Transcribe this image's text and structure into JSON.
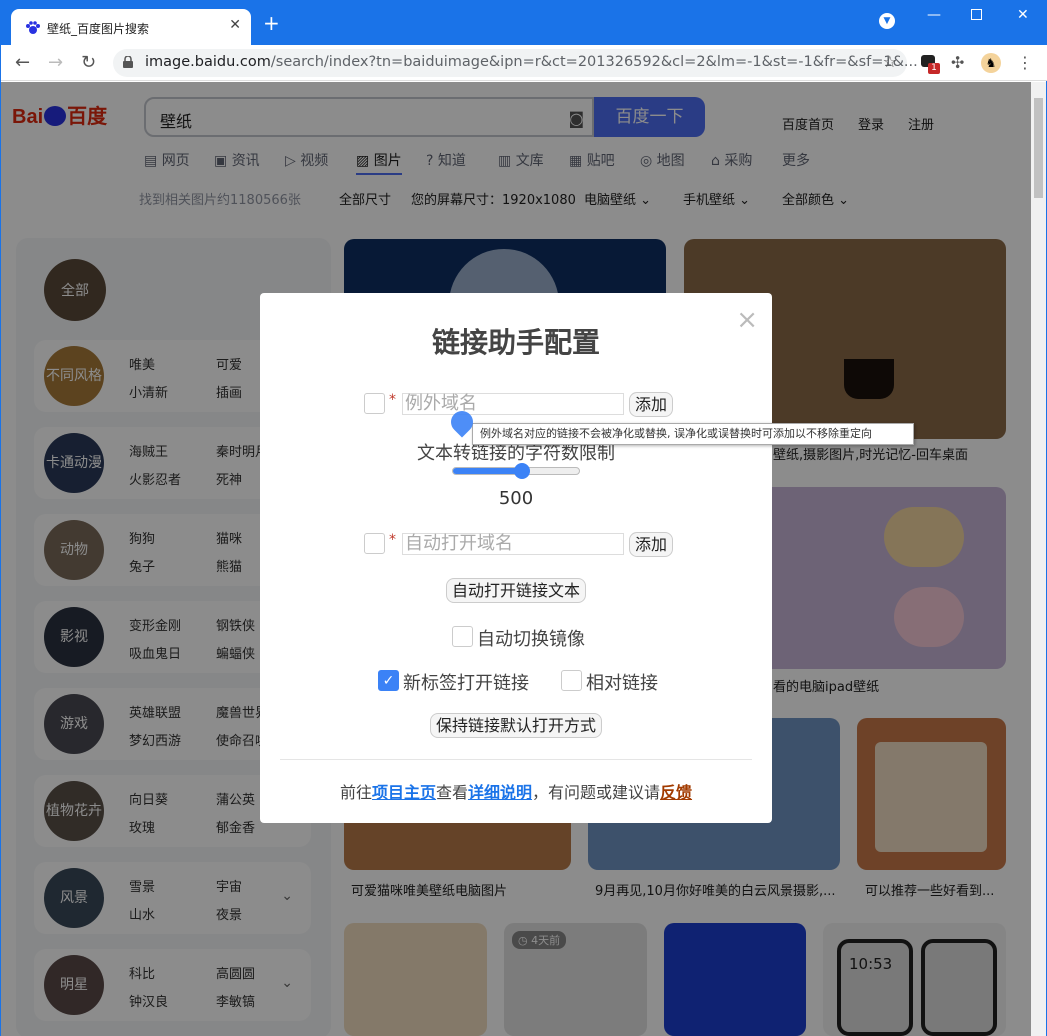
{
  "browser": {
    "tab_title": "壁纸_百度图片搜索",
    "url_host": "image.baidu.com",
    "url_path": "/search/index?tn=baiduimage&ipn=r&ct=201326592&cl=2&lm=-1&st=-1&fr=&sf=1&...",
    "ext_badge": "1",
    "colors": {
      "frame": "#1a73e8"
    }
  },
  "baidu": {
    "logo_bai": "Bai",
    "logo_cn": "百度",
    "query": "壁纸",
    "search_button": "百度一下",
    "top_links": [
      "百度首页",
      "登录",
      "注册"
    ],
    "nav_tabs": [
      "网页",
      "资讯",
      "视频",
      "图片",
      "知道",
      "文库",
      "贴吧",
      "地图",
      "采购",
      "更多"
    ],
    "result_count": "找到相关图片约1180566张",
    "filters": {
      "all_size": "全部尺寸",
      "screen_size": "您的屏幕尺寸：1920x1080",
      "pc": "电脑壁纸",
      "mobile": "手机壁纸",
      "color": "全部颜色"
    },
    "categories": [
      {
        "circle": "全部",
        "items": []
      },
      {
        "circle": "不同风格",
        "items": [
          "唯美",
          "可爱",
          "小清新",
          "插画"
        ]
      },
      {
        "circle": "卡通动漫",
        "items": [
          "海贼王",
          "秦时明月",
          "火影忍者",
          "死神"
        ]
      },
      {
        "circle": "动物",
        "items": [
          "狗狗",
          "猫咪",
          "兔子",
          "熊猫"
        ]
      },
      {
        "circle": "影视",
        "items": [
          "变形金刚",
          "钢铁侠",
          "吸血鬼日",
          "蝙蝠侠"
        ]
      },
      {
        "circle": "游戏",
        "items": [
          "英雄联盟",
          "魔兽世界",
          "梦幻西游",
          "使命召唤"
        ]
      },
      {
        "circle": "植物花卉",
        "items": [
          "向日葵",
          "蒲公英",
          "玫瑰",
          "郁金香"
        ]
      },
      {
        "circle": "风景",
        "items": [
          "雪景",
          "宇宙",
          "山水",
          "夜景"
        ]
      },
      {
        "circle": "明星",
        "items": [
          "科比",
          "高圆圆",
          "钟汉良",
          "李敏镐"
        ]
      }
    ],
    "captions": [
      "壁纸,摄影图片,时光记忆-回车桌面",
      "看的电脑ipad壁纸",
      "可爱猫咪唯美壁纸电脑图片",
      "9月再见,10月你好唯美的白云风景摄影,...",
      "可以推荐一些好看到..."
    ],
    "time_badge": "4天前",
    "phone_time": "10:53"
  },
  "modal": {
    "title": "链接助手配置",
    "close": "×",
    "req_mark": "*",
    "exclude_placeholder": "例外域名",
    "add_label": "添加",
    "tooltip": "例外域名对应的链接不会被净化或替换, 误净化或误替换时可添加以不移除重定向",
    "text_limit_label": "文本转链接的字符数限制",
    "slider_value": "500",
    "slider_fraction": 0.55,
    "autoopen_placeholder": "自动打开域名",
    "autoopen_text_button": "自动打开链接文本",
    "auto_mirror_label": "自动切换镜像",
    "new_tab_label": "新标签打开链接",
    "new_tab_checked": true,
    "relative_label": "相对链接",
    "keep_default_button": "保持链接默认打开方式",
    "footer": {
      "pre": "前往",
      "home": "项目主页",
      "mid": "查看",
      "details": "详细说明",
      "mid2": "，有问题或建议请",
      "feedback": "反馈"
    }
  }
}
